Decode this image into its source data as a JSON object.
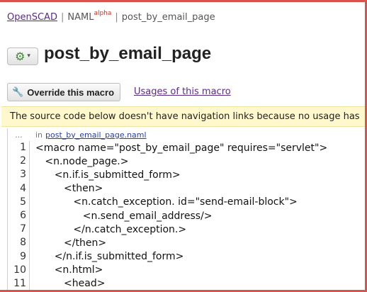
{
  "breadcrumb": {
    "root": "OpenSCAD",
    "section": "NAML",
    "section_sup": "alpha",
    "separator": "|",
    "current": "post_by_email_page"
  },
  "page": {
    "title": "post_by_email_page",
    "gear_icon": "gear-icon",
    "override_label": "Override this macro",
    "usages_label": "Usages of this macro",
    "notice": "The source code below doesn't have navigation links because no usage has"
  },
  "code": {
    "dots": "...",
    "in_label": "in",
    "file": "post_by_email_page.naml",
    "lines": [
      {
        "n": "1",
        "text": "<macro name=\"post_by_email_page\" requires=\"servlet\">"
      },
      {
        "n": "2",
        "text": "   <n.node_page.>"
      },
      {
        "n": "3",
        "text": "      <n.if.is_submitted_form>"
      },
      {
        "n": "4",
        "text": "         <then>"
      },
      {
        "n": "5",
        "text": "            <n.catch_exception. id=\"send-email-block\">"
      },
      {
        "n": "6",
        "text": "               <n.send_email_address/>"
      },
      {
        "n": "7",
        "text": "            </n.catch_exception.>"
      },
      {
        "n": "8",
        "text": "         </then>"
      },
      {
        "n": "9",
        "text": "      </n.if.is_submitted_form>"
      },
      {
        "n": "10",
        "text": "      <n.html>"
      },
      {
        "n": "11",
        "text": "         <head>"
      }
    ]
  }
}
